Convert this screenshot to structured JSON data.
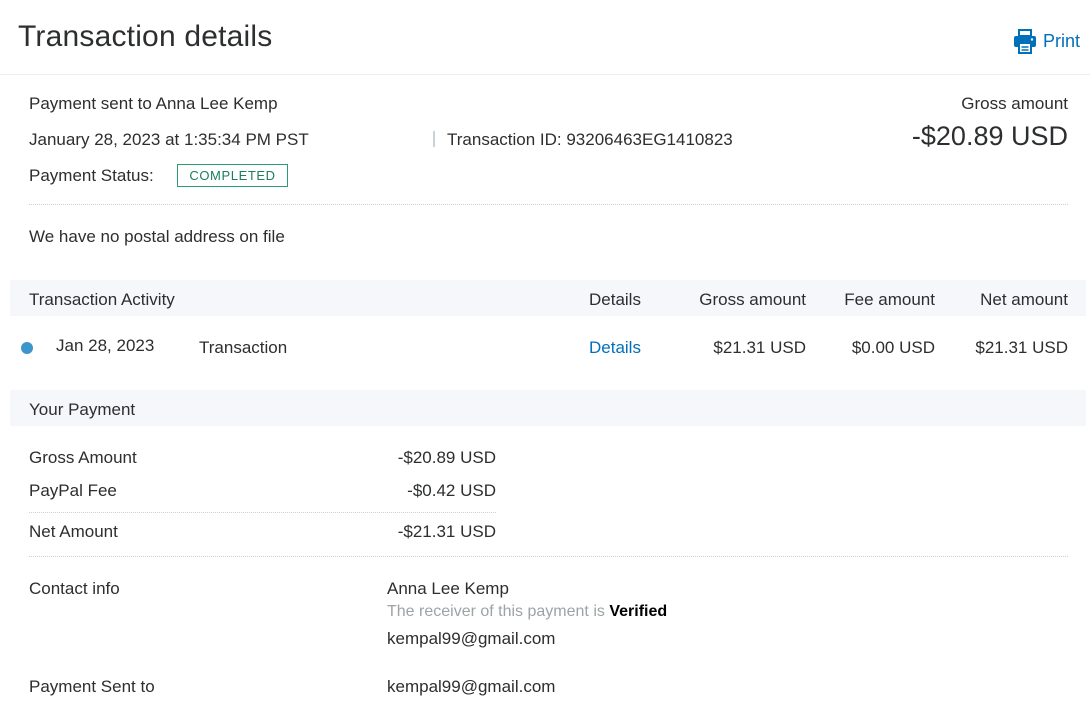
{
  "header": {
    "title": "Transaction details",
    "print_label": "Print"
  },
  "summary": {
    "payment_sent_to": "Payment sent to Anna Lee Kemp",
    "datetime": "January 28, 2023 at 1:35:34 PM PST",
    "transaction_id": "Transaction ID: 93206463EG1410823",
    "status_label": "Payment Status:",
    "status_value": "COMPLETED",
    "gross_label": "Gross amount",
    "gross_value": "-$20.89 USD",
    "postal_note": "We have no postal address on file"
  },
  "activity": {
    "headers": [
      "Transaction Activity",
      "Details",
      "Gross amount",
      "Fee amount",
      "Net amount"
    ],
    "rows": [
      {
        "date": "Jan 28, 2023",
        "type": "Transaction",
        "details_link": "Details",
        "gross": "$21.31 USD",
        "fee": "$0.00 USD",
        "net": "$21.31 USD"
      }
    ]
  },
  "your_payment": {
    "title": "Your Payment",
    "rows": [
      {
        "label": "Gross Amount",
        "value": "-$20.89 USD"
      },
      {
        "label": "PayPal Fee",
        "value": "-$0.42 USD"
      },
      {
        "label": "Net Amount",
        "value": "-$21.31 USD"
      }
    ]
  },
  "contact": {
    "label": "Contact info",
    "name": "Anna Lee Kemp",
    "receiver_note": "The receiver of this payment is",
    "verified": "Verified",
    "email": "kempal99@gmail.com"
  },
  "sent_to": {
    "label": "Payment Sent to",
    "value": "kempal99@gmail.com"
  },
  "colors": {
    "link": "#0070ba",
    "status_green": "#1a7f5a",
    "dot_blue": "#3d95ce",
    "section_bg": "#f5f7fa"
  },
  "icons": {
    "print": "printer-icon",
    "activity_dot": "status-dot-icon"
  }
}
